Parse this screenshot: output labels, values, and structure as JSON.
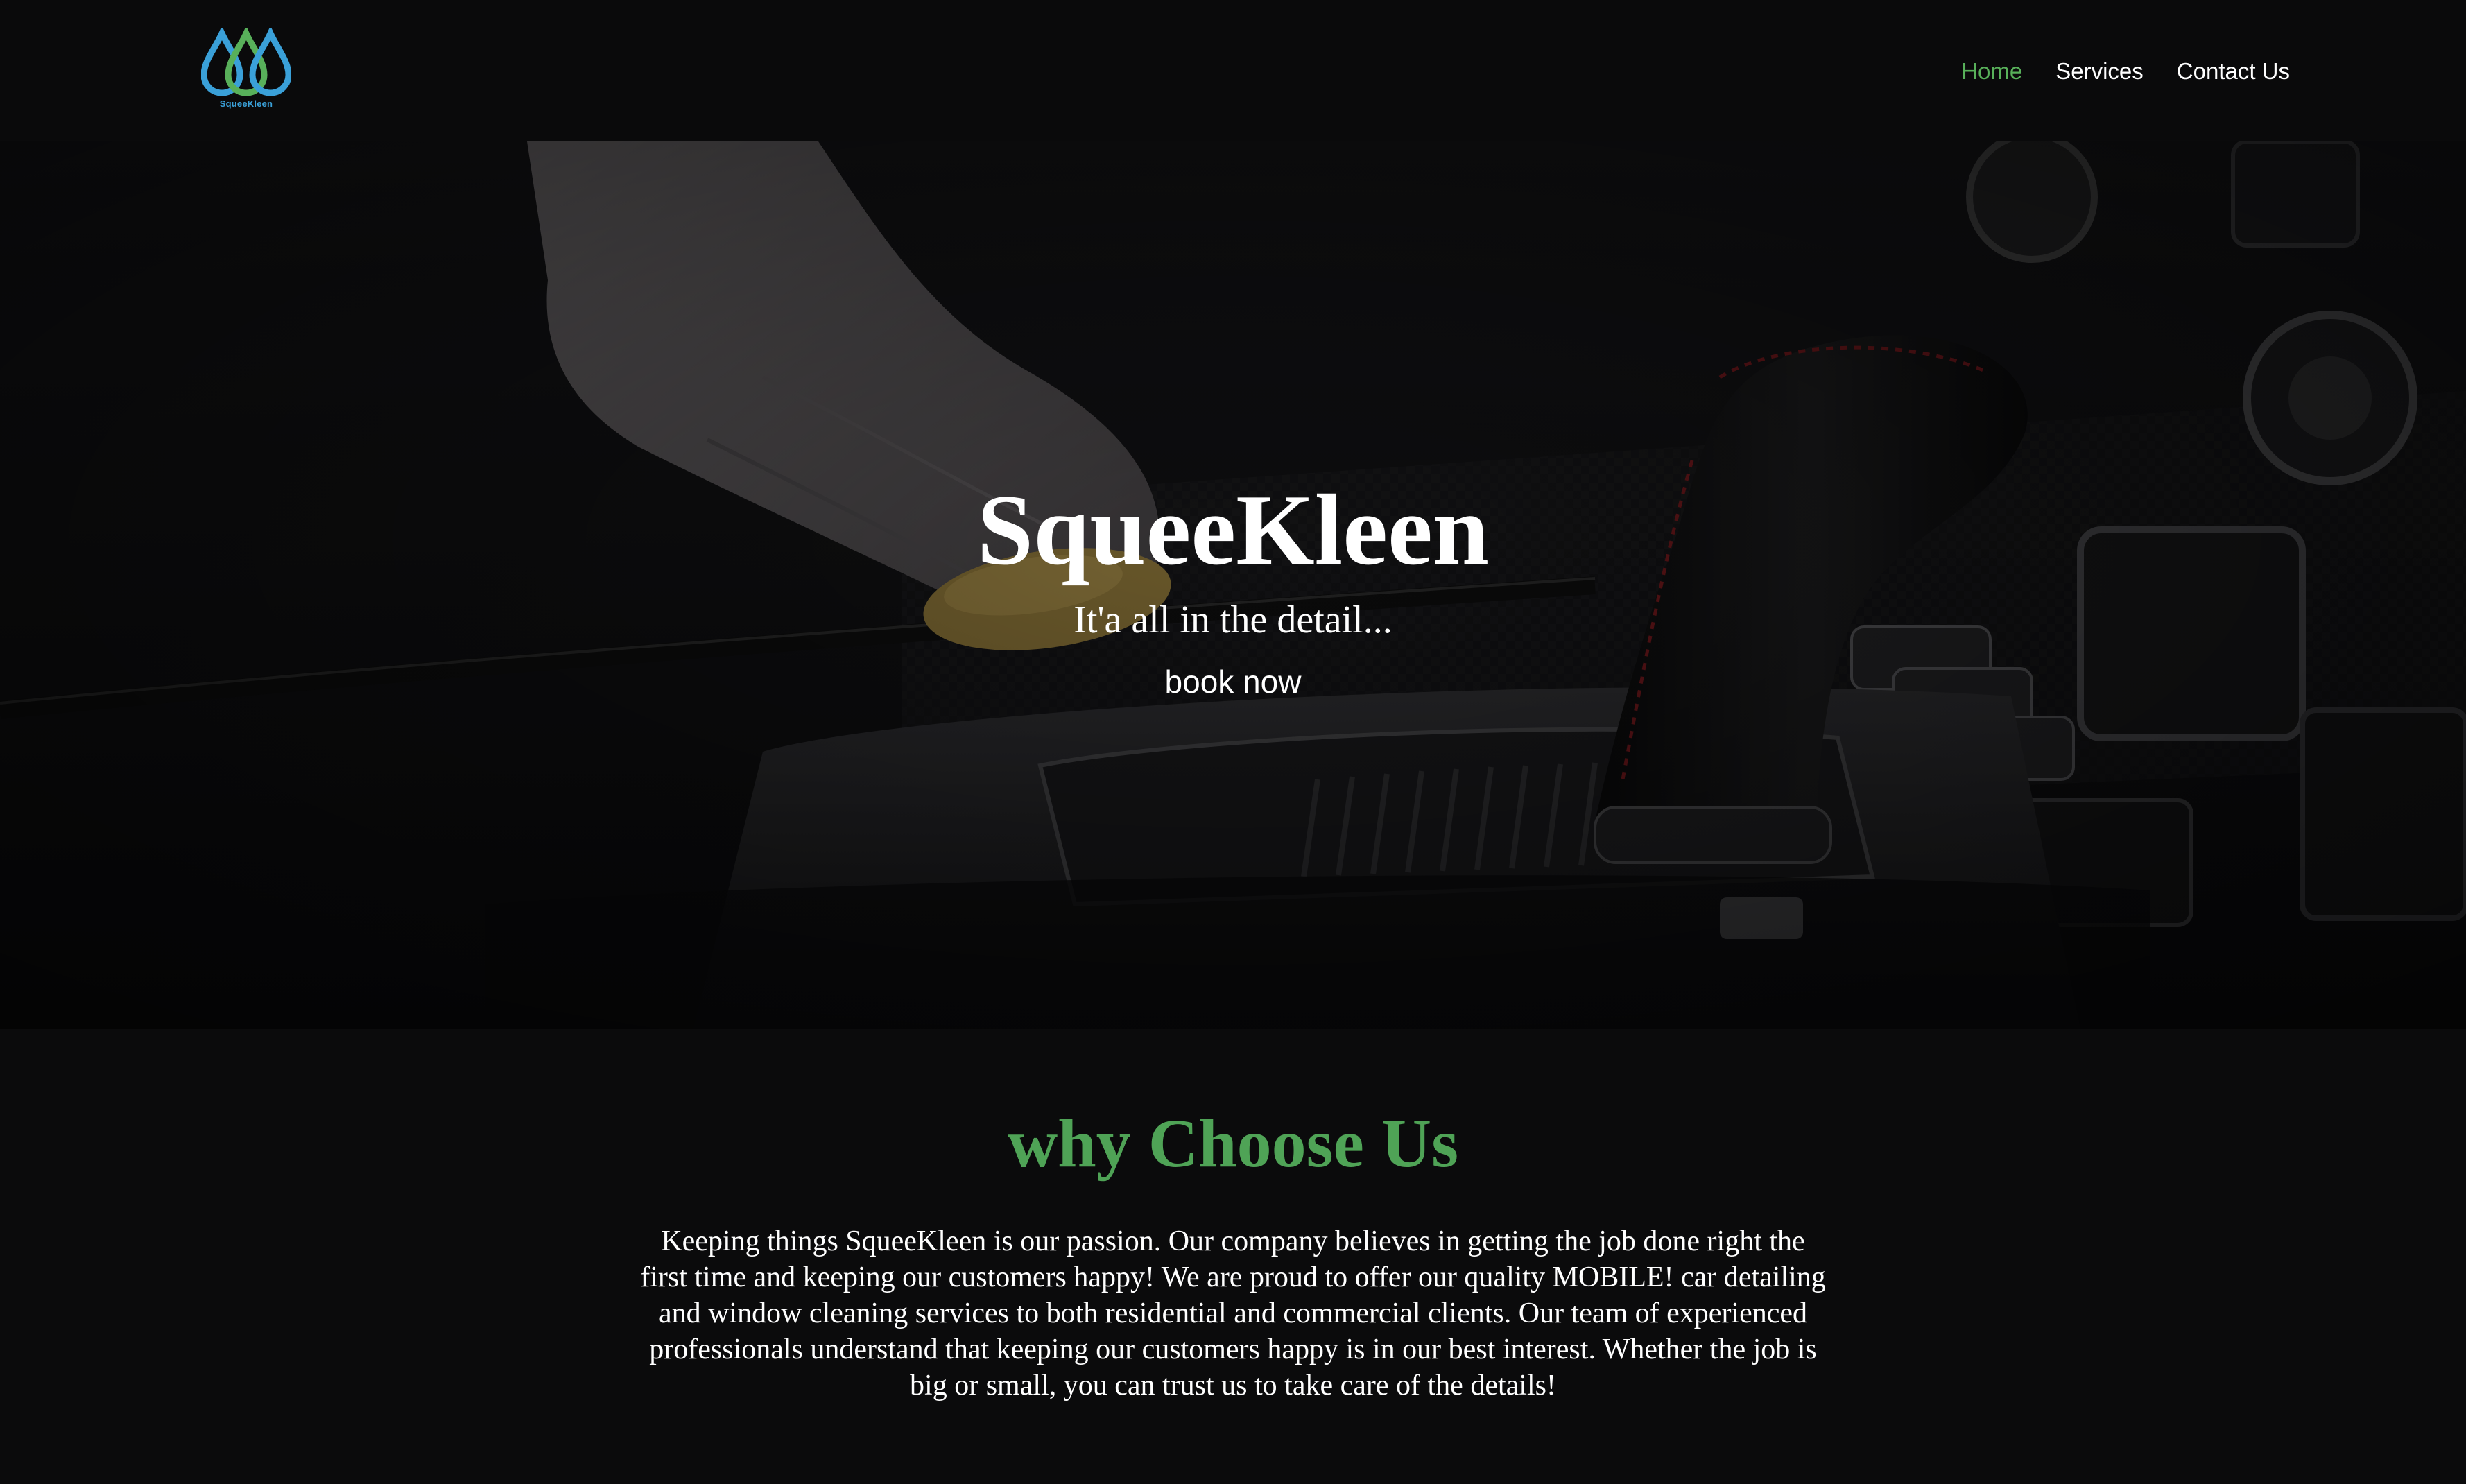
{
  "brand": {
    "logo_text": "SqueeKleen",
    "colors": {
      "drop_blue": "#3aa0d8",
      "drop_green": "#58b05a"
    }
  },
  "nav": {
    "items": [
      {
        "label": "Home",
        "active": true
      },
      {
        "label": "Services",
        "active": false
      },
      {
        "label": "Contact Us",
        "active": false
      }
    ]
  },
  "hero": {
    "title": "SqueeKleen",
    "subtitle": "It'a all in the detail...",
    "cta_label": "book now",
    "image_subject": "gloved hand detailing car interior near gear shifter"
  },
  "why": {
    "title": "why Choose Us",
    "body": "Keeping things SqueeKleen is our passion. Our company believes in getting the job done right the first time and keeping our customers happy! We are proud to offer our quality MOBILE! car detailing and window cleaning services to both residential and commercial clients. Our team of experienced professionals understand that keeping our customers happy is in our best interest. Whether the job is big or small, you can trust us to take care of the details!"
  },
  "theme": {
    "background": "#0b0b0c",
    "accent_green": "#58b05a",
    "text": "#ffffff"
  }
}
